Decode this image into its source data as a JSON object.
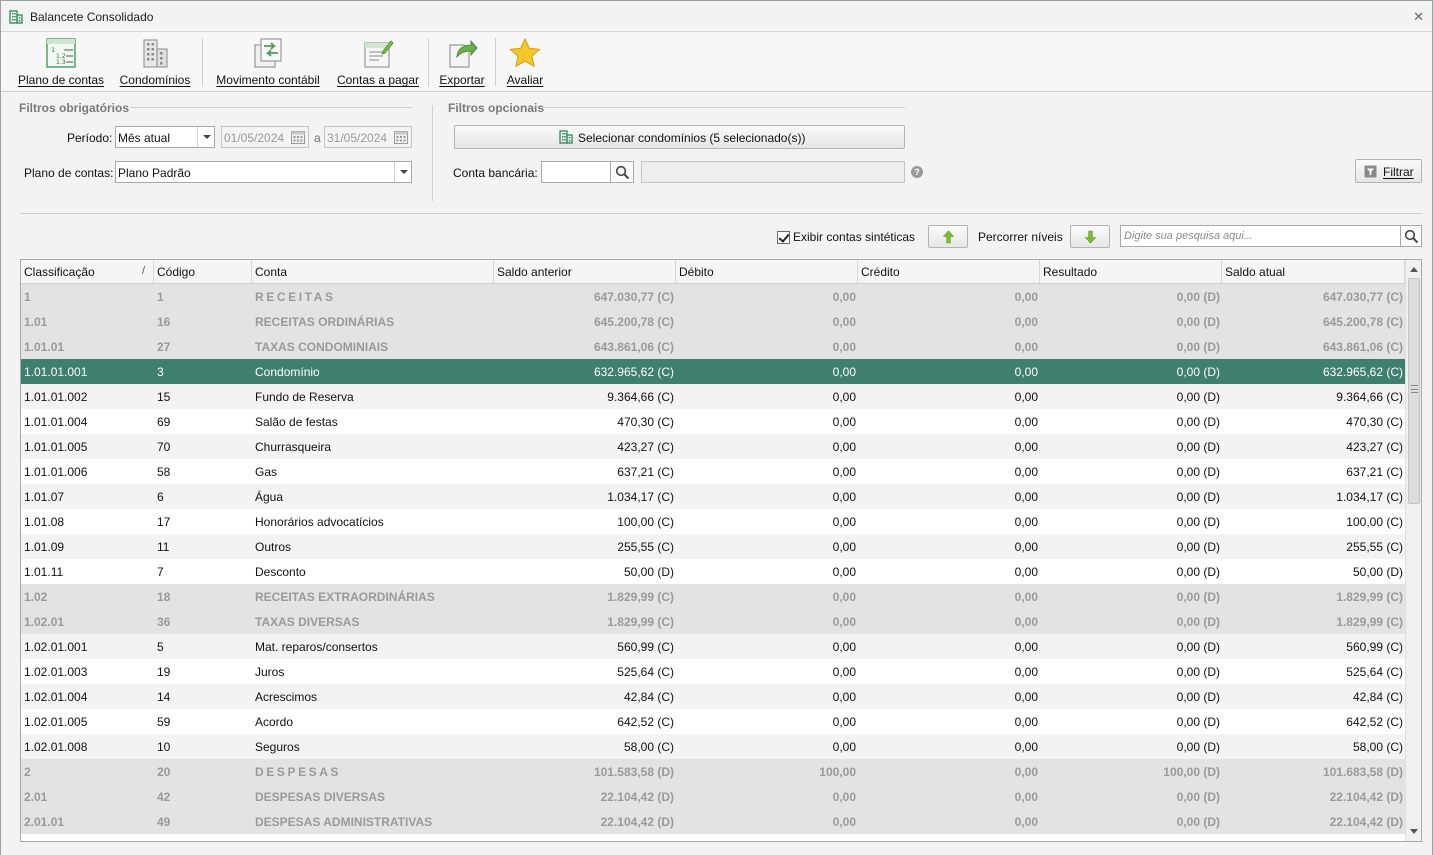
{
  "window": {
    "title": "Balancete Consolidado",
    "title_icon": "building-icon",
    "close_icon": "close-icon"
  },
  "toolbar": {
    "items": [
      {
        "label": "Plano de contas",
        "icon": "chart-of-accounts-icon"
      },
      {
        "label": "Condomínios",
        "icon": "buildings-icon"
      },
      {
        "label": "Movimento contábil",
        "icon": "accounting-movement-icon"
      },
      {
        "label": "Contas a pagar",
        "icon": "bills-payable-icon"
      },
      {
        "label": "Exportar",
        "icon": "export-icon"
      },
      {
        "label": "Avaliar",
        "icon": "star-icon"
      }
    ]
  },
  "filters": {
    "required_title": "Filtros obrigatórios",
    "optional_title": "Filtros opcionais",
    "period_label": "Período:",
    "period_value": "Mês atual",
    "date_from": "01/05/2024",
    "date_sep": "a",
    "date_to": "31/05/2024",
    "plan_label": "Plano de contas:",
    "plan_value": "Plano Padrão",
    "select_condos_label": "Selecionar condomínios (5 selecionado(s))",
    "bank_label": "Conta bancária:",
    "bank_value": "",
    "bank_desc": "",
    "help": "?",
    "filter_button": "Filtrar"
  },
  "options": {
    "show_synthetic_label": "Exibir contas sintéticas",
    "show_synthetic_checked": true,
    "levels_label": "Percorrer níveis",
    "search_placeholder": "Digite sua pesquisa aqui..."
  },
  "colors": {
    "selected_row": "#3e7f6e",
    "synthetic_row": "#e3e3e3",
    "synthetic_text": "#9a9a9a",
    "accent_green": "#6aaa3a"
  },
  "grid": {
    "columns": [
      "Classificação",
      "Código",
      "Conta",
      "Saldo anterior",
      "Débito",
      "Crédito",
      "Resultado",
      "Saldo atual"
    ],
    "sort_indicator": "/",
    "rows": [
      {
        "type": "synth",
        "c": [
          "1",
          "1",
          "RECEITAS",
          "647.030,77 (C)",
          "0,00",
          "0,00",
          "0,00 (D)",
          "647.030,77 (C)"
        ]
      },
      {
        "type": "synth",
        "c": [
          "1.01",
          "16",
          "RECEITAS ORDINÁRIAS",
          "645.200,78 (C)",
          "0,00",
          "0,00",
          "0,00 (D)",
          "645.200,78 (C)"
        ]
      },
      {
        "type": "synth",
        "c": [
          "1.01.01",
          "27",
          "TAXAS CONDOMINIAIS",
          "643.861,06 (C)",
          "0,00",
          "0,00",
          "0,00 (D)",
          "643.861,06 (C)"
        ]
      },
      {
        "type": "sel",
        "c": [
          "1.01.01.001",
          "3",
          "Condomínio",
          "632.965,62 (C)",
          "0,00",
          "0,00",
          "0,00 (D)",
          "632.965,62 (C)"
        ]
      },
      {
        "type": "normal",
        "c": [
          "1.01.01.002",
          "15",
          "Fundo  de Reserva",
          "9.364,66 (C)",
          "0,00",
          "0,00",
          "0,00 (D)",
          "9.364,66 (C)"
        ]
      },
      {
        "type": "normal",
        "c": [
          "1.01.01.004",
          "69",
          "Salão de festas",
          "470,30 (C)",
          "0,00",
          "0,00",
          "0,00 (D)",
          "470,30 (C)"
        ]
      },
      {
        "type": "normal",
        "c": [
          "1.01.01.005",
          "70",
          "Churrasqueira",
          "423,27 (C)",
          "0,00",
          "0,00",
          "0,00 (D)",
          "423,27 (C)"
        ]
      },
      {
        "type": "normal",
        "c": [
          "1.01.01.006",
          "58",
          "Gas",
          "637,21 (C)",
          "0,00",
          "0,00",
          "0,00 (D)",
          "637,21 (C)"
        ]
      },
      {
        "type": "normal",
        "c": [
          "1.01.07",
          "6",
          "Água",
          "1.034,17 (C)",
          "0,00",
          "0,00",
          "0,00 (D)",
          "1.034,17 (C)"
        ]
      },
      {
        "type": "normal",
        "c": [
          "1.01.08",
          "17",
          "Honorários advocatícios",
          "100,00 (C)",
          "0,00",
          "0,00",
          "0,00 (D)",
          "100,00 (C)"
        ]
      },
      {
        "type": "normal",
        "c": [
          "1.01.09",
          "11",
          "Outros",
          "255,55 (C)",
          "0,00",
          "0,00",
          "0,00 (D)",
          "255,55 (C)"
        ]
      },
      {
        "type": "normal",
        "c": [
          "1.01.11",
          "7",
          "Desconto",
          "50,00 (D)",
          "0,00",
          "0,00",
          "0,00 (D)",
          "50,00 (D)"
        ]
      },
      {
        "type": "synth",
        "c": [
          "1.02",
          "18",
          "RECEITAS EXTRAORDINÁRIAS",
          "1.829,99 (C)",
          "0,00",
          "0,00",
          "0,00 (D)",
          "1.829,99 (C)"
        ]
      },
      {
        "type": "synth",
        "c": [
          "1.02.01",
          "36",
          "TAXAS DIVERSAS",
          "1.829,99 (C)",
          "0,00",
          "0,00",
          "0,00 (D)",
          "1.829,99 (C)"
        ]
      },
      {
        "type": "normal",
        "c": [
          "1.02.01.001",
          "5",
          "Mat. reparos/consertos",
          "560,99 (C)",
          "0,00",
          "0,00",
          "0,00 (D)",
          "560,99 (C)"
        ]
      },
      {
        "type": "normal",
        "c": [
          "1.02.01.003",
          "19",
          "Juros",
          "525,64 (C)",
          "0,00",
          "0,00",
          "0,00 (D)",
          "525,64 (C)"
        ]
      },
      {
        "type": "normal",
        "c": [
          "1.02.01.004",
          "14",
          "Acrescimos",
          "42,84 (C)",
          "0,00",
          "0,00",
          "0,00 (D)",
          "42,84 (C)"
        ]
      },
      {
        "type": "normal",
        "c": [
          "1.02.01.005",
          "59",
          "Acordo",
          "642,52 (C)",
          "0,00",
          "0,00",
          "0,00 (D)",
          "642,52 (C)"
        ]
      },
      {
        "type": "normal",
        "c": [
          "1.02.01.008",
          "10",
          "Seguros",
          "58,00 (C)",
          "0,00",
          "0,00",
          "0,00 (D)",
          "58,00 (C)"
        ]
      },
      {
        "type": "synth",
        "c": [
          "2",
          "20",
          "DESPESAS",
          "101.583,58 (D)",
          "100,00",
          "0,00",
          "100,00 (D)",
          "101.683,58 (D)"
        ]
      },
      {
        "type": "synth",
        "c": [
          "2.01",
          "42",
          "DESPESAS DIVERSAS",
          "22.104,42 (D)",
          "0,00",
          "0,00",
          "0,00 (D)",
          "22.104,42 (D)"
        ]
      },
      {
        "type": "synth",
        "c": [
          "2.01.01",
          "49",
          "DESPESAS ADMINISTRATIVAS",
          "22.104,42 (D)",
          "0,00",
          "0,00",
          "0,00 (D)",
          "22.104,42 (D)"
        ]
      }
    ]
  }
}
